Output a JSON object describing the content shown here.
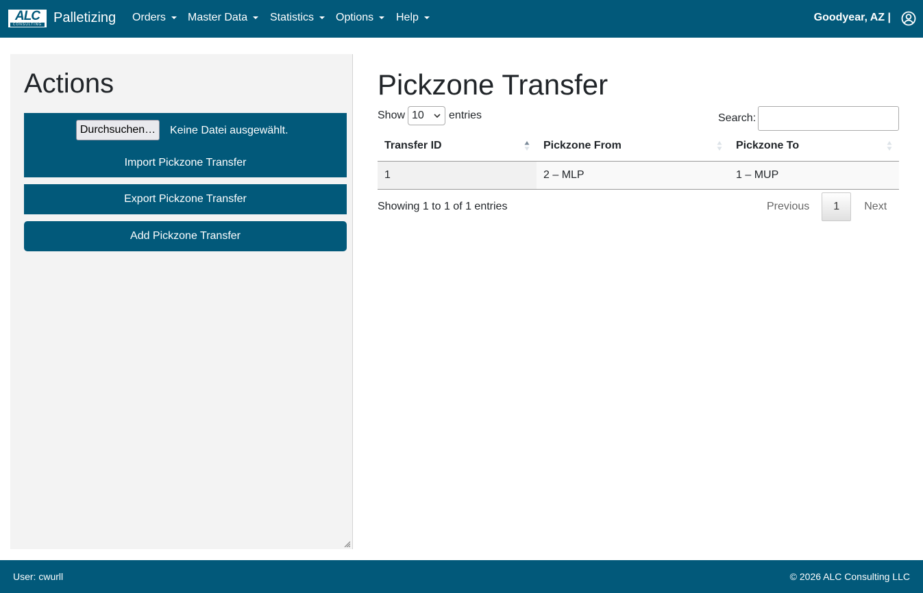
{
  "navbar": {
    "logo_text": "ALC",
    "logo_subtext": "CONSULTING",
    "brand": "Palletizing",
    "menus": [
      {
        "label": "Orders"
      },
      {
        "label": "Master Data"
      },
      {
        "label": "Statistics"
      },
      {
        "label": "Options"
      },
      {
        "label": "Help"
      }
    ],
    "location": "Goodyear, AZ |",
    "user_icon": "user-circle-icon"
  },
  "sidebar": {
    "title": "Actions",
    "file_button": "Durchsuchen…",
    "file_status": "Keine Datei ausgewählt.",
    "import_label": "Import Pickzone Transfer",
    "export_label": "Export Pickzone Transfer",
    "add_label": "Add Pickzone Transfer"
  },
  "main": {
    "title": "Pickzone Transfer",
    "length": {
      "show": "Show",
      "value": "10",
      "entries": "entries"
    },
    "search": {
      "label": "Search:",
      "value": ""
    },
    "table": {
      "columns": [
        "Transfer ID",
        "Pickzone From",
        "Pickzone To"
      ],
      "rows": [
        [
          "1",
          "2 – MLP",
          "1 – MUP"
        ]
      ]
    },
    "info": "Showing 1 to 1 of 1 entries",
    "pagination": {
      "previous": "Previous",
      "current": "1",
      "next": "Next"
    }
  },
  "footer": {
    "user": "User: cwurll",
    "copyright": "© 2026 ALC Consulting LLC"
  },
  "colors": {
    "primary": "#02597a",
    "sidebar_bg": "#f3f3f3"
  }
}
